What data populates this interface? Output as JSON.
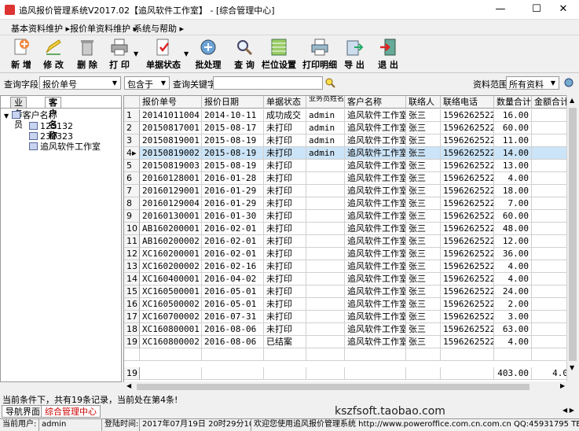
{
  "window": {
    "title": "追风报价管理系统V2017.02【追风软件工作室】 - [综合管理中心]"
  },
  "menu": [
    "基本资料维护 ▸",
    "报价单资料维护 ▸",
    "系统与帮助 ▸"
  ],
  "toolbar": {
    "add": "新 增",
    "edit": "修 改",
    "delete": "删 除",
    "print": "打 印",
    "status": "单据状态",
    "batch": "批处理",
    "query": "查 询",
    "columns": "栏位设置",
    "print_detail": "打印明细",
    "export": "导 出",
    "exit": "退 出"
  },
  "filter": {
    "field_label": "查询字段",
    "field_value": "报价单号",
    "op_value": "包含于",
    "keyword_label": "查询关键字",
    "keyword_value": "",
    "range_label": "资料范围",
    "range_value": "所有资料"
  },
  "left": {
    "tabs": [
      "业务员",
      "客户名称"
    ],
    "root": "客户名称",
    "children": [
      "123132",
      "232323",
      "追风软件工作室"
    ]
  },
  "grid": {
    "headers": [
      "报价单号",
      "报价日期",
      "单据状态",
      "业务员姓名",
      "客户名称",
      "联络人",
      "联络电话",
      "数量合计",
      "金额合计"
    ],
    "selected_row": 4,
    "rows": [
      [
        "20141011004",
        "2014-10-11",
        "成功成交",
        "admin",
        "追风软件工作室",
        "张三",
        "15962625220",
        "16.00"
      ],
      [
        "20150817001",
        "2015-08-17",
        "未打印",
        "admin",
        "追风软件工作室",
        "张三",
        "15962625220",
        "60.00"
      ],
      [
        "20150819001",
        "2015-08-19",
        "未打印",
        "admin",
        "追风软件工作室",
        "张三",
        "15962625220",
        "11.00"
      ],
      [
        "20150819002",
        "2015-08-19",
        "未打印",
        "admin",
        "追风软件工作室",
        "张三",
        "15962625220",
        "14.00"
      ],
      [
        "20150819003",
        "2015-08-19",
        "未打印",
        "",
        "追风软件工作室",
        "张三",
        "15962625220",
        "13.00"
      ],
      [
        "20160128001",
        "2016-01-28",
        "未打印",
        "",
        "追风软件工作室",
        "张三",
        "15962625220",
        "4.00"
      ],
      [
        "20160129001",
        "2016-01-29",
        "未打印",
        "",
        "追风软件工作室",
        "张三",
        "15962625220",
        "18.00"
      ],
      [
        "20160129004",
        "2016-01-29",
        "未打印",
        "",
        "追风软件工作室",
        "张三",
        "15962625220",
        "7.00"
      ],
      [
        "20160130001",
        "2016-01-30",
        "未打印",
        "",
        "追风软件工作室",
        "张三",
        "15962625220",
        "60.00"
      ],
      [
        "AB160200001",
        "2016-02-01",
        "未打印",
        "",
        "追风软件工作室",
        "张三",
        "15962625220",
        "48.00"
      ],
      [
        "AB160200002",
        "2016-02-01",
        "未打印",
        "",
        "追风软件工作室",
        "张三",
        "15962625220",
        "12.00"
      ],
      [
        "XC160200001",
        "2016-02-01",
        "未打印",
        "",
        "追风软件工作室",
        "张三",
        "15962625220",
        "36.00"
      ],
      [
        "XC160200002",
        "2016-02-16",
        "未打印",
        "",
        "追风软件工作室",
        "张三",
        "15962625220",
        "4.00"
      ],
      [
        "XC160400001",
        "2016-04-02",
        "未打印",
        "",
        "追风软件工作室",
        "张三",
        "15962625220",
        "4.00"
      ],
      [
        "XC160500001",
        "2016-05-01",
        "未打印",
        "",
        "追风软件工作室",
        "张三",
        "15962625220",
        "24.00"
      ],
      [
        "XC160500002",
        "2016-05-01",
        "未打印",
        "",
        "追风软件工作室",
        "张三",
        "15962625220",
        "2.00"
      ],
      [
        "XC160700002",
        "2016-07-31",
        "未打印",
        "",
        "追风软件工作室",
        "张三",
        "15962625220",
        "3.00"
      ],
      [
        "XC160800001",
        "2016-08-06",
        "未打印",
        "",
        "追风软件工作室",
        "张三",
        "15962625220",
        "63.00"
      ],
      [
        "XC160800002",
        "2016-08-06",
        "已结案",
        "",
        "追风软件工作室",
        "张三",
        "15962625220",
        "4.00"
      ]
    ],
    "footer_count": "19",
    "footer_qty": "403.00",
    "footer_amt": "4.0"
  },
  "status": {
    "condition": "当前条件下，共有19条记录，当前处在第4条!",
    "nav_tabs": [
      "导航界面",
      "综合管理中心"
    ],
    "user_label": "当前用户:",
    "user": "admin",
    "login_label": "登陆时间:",
    "login_time": "2017年07月19日 20时29分10秒",
    "welcome": "欢迎您使用追风报价管理系统 http://www.poweroffice.com.cn.com.cn QQ:45931795 TEL:1596262",
    "watermark": "kszfsoft.taobao.com"
  }
}
